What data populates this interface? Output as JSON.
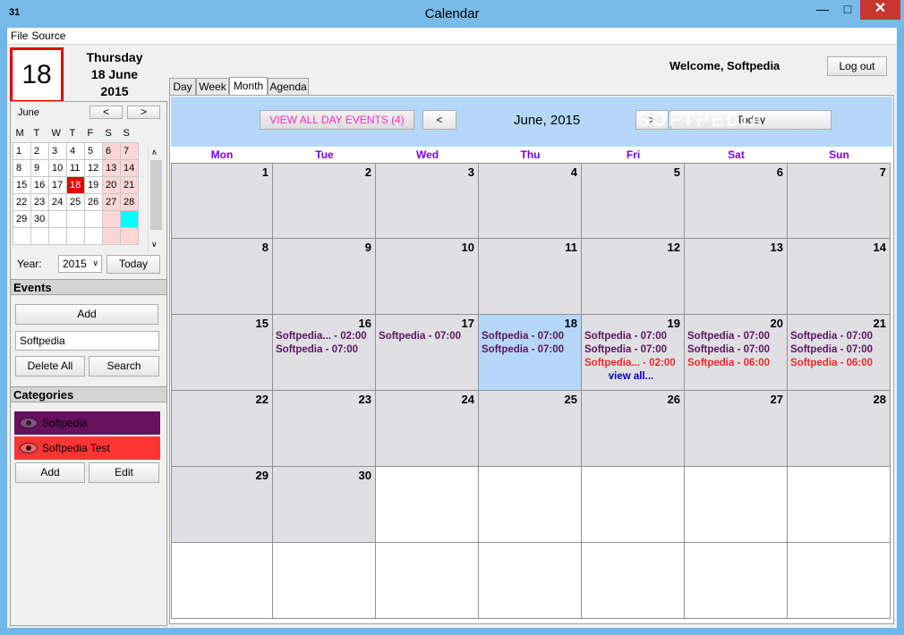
{
  "window": {
    "title": "Calendar",
    "app_icon": "31"
  },
  "menu": [
    "File",
    "Source"
  ],
  "header": {
    "big_day": "18",
    "weekday": "Thursday",
    "date_line": "18 June",
    "year_line": "2015",
    "welcome": "Welcome, Softpedia",
    "logout": "Log out"
  },
  "mini_calendar": {
    "month": "June",
    "prev": "<",
    "next": ">",
    "day_headers": [
      "M",
      "T",
      "W",
      "T",
      "F",
      "S",
      "S"
    ],
    "weeks": [
      [
        "1",
        "2",
        "3",
        "4",
        "5",
        "6",
        "7"
      ],
      [
        "8",
        "9",
        "10",
        "11",
        "12",
        "13",
        "14"
      ],
      [
        "15",
        "16",
        "17",
        "18",
        "19",
        "20",
        "21"
      ],
      [
        "22",
        "23",
        "24",
        "25",
        "26",
        "27",
        "28"
      ],
      [
        "29",
        "30",
        "",
        "",
        "",
        "",
        ""
      ],
      [
        "",
        "",
        "",
        "",
        "",
        "",
        ""
      ]
    ],
    "selected_day": "18",
    "year_label": "Year:",
    "year_value": "2015",
    "today_button": "Today"
  },
  "events_panel": {
    "title": "Events",
    "add": "Add",
    "search_value": "Softpedia",
    "delete_all": "Delete All",
    "search": "Search"
  },
  "categories_panel": {
    "title": "Categories",
    "items": [
      {
        "name": "Softpedia",
        "color": "#66105e"
      },
      {
        "name": "Softpedia Test",
        "color": "#ff3434"
      }
    ],
    "add": "Add",
    "edit": "Edit"
  },
  "tabs": [
    "Day",
    "Week",
    "Month",
    "Agenda"
  ],
  "active_tab": "Month",
  "toolbar": {
    "view_all": "VIEW ALL DAY EVENTS (4)",
    "prev": "<",
    "next": ">",
    "month_title": "June, 2015",
    "today": "Today",
    "watermark": "SOFTPEDIA"
  },
  "weekdays": [
    "Mon",
    "Tue",
    "Wed",
    "Thu",
    "Fri",
    "Sat",
    "Sun"
  ],
  "weeks": [
    [
      "1",
      "2",
      "3",
      "4",
      "5",
      "6",
      "7"
    ],
    [
      "8",
      "9",
      "10",
      "11",
      "12",
      "13",
      "14"
    ],
    [
      "15",
      "16",
      "17",
      "18",
      "19",
      "20",
      "21"
    ],
    [
      "22",
      "23",
      "24",
      "25",
      "26",
      "27",
      "28"
    ],
    [
      "29",
      "30",
      "",
      "",
      "",
      "",
      ""
    ],
    [
      "",
      "",
      "",
      "",
      "",
      "",
      ""
    ]
  ],
  "today": "18",
  "events": {
    "16": [
      {
        "text": "Softpedia... - 02:00",
        "style": "p"
      },
      {
        "text": "Softpedia - 07:00",
        "style": "p"
      }
    ],
    "17": [
      {
        "text": "Softpedia - 07:00",
        "style": "p"
      }
    ],
    "18": [
      {
        "text": "Softpedia - 07:00",
        "style": "p"
      },
      {
        "text": "Softpedia - 07:00",
        "style": "p"
      }
    ],
    "19": [
      {
        "text": "Softpedia - 07:00",
        "style": "p"
      },
      {
        "text": "Softpedia - 07:00",
        "style": "p"
      },
      {
        "text": "Softpedia... - 02:00",
        "style": "r"
      },
      {
        "text": "view all...",
        "style": "v"
      }
    ],
    "20": [
      {
        "text": "Softpedia - 07:00",
        "style": "p"
      },
      {
        "text": "Softpedia - 07:00",
        "style": "p"
      },
      {
        "text": "Softpedia - 06:00",
        "style": "r"
      }
    ],
    "21": [
      {
        "text": "Softpedia - 07:00",
        "style": "p"
      },
      {
        "text": "Softpedia - 07:00",
        "style": "p"
      },
      {
        "text": "Softpedia - 06:00",
        "style": "r"
      }
    ]
  }
}
